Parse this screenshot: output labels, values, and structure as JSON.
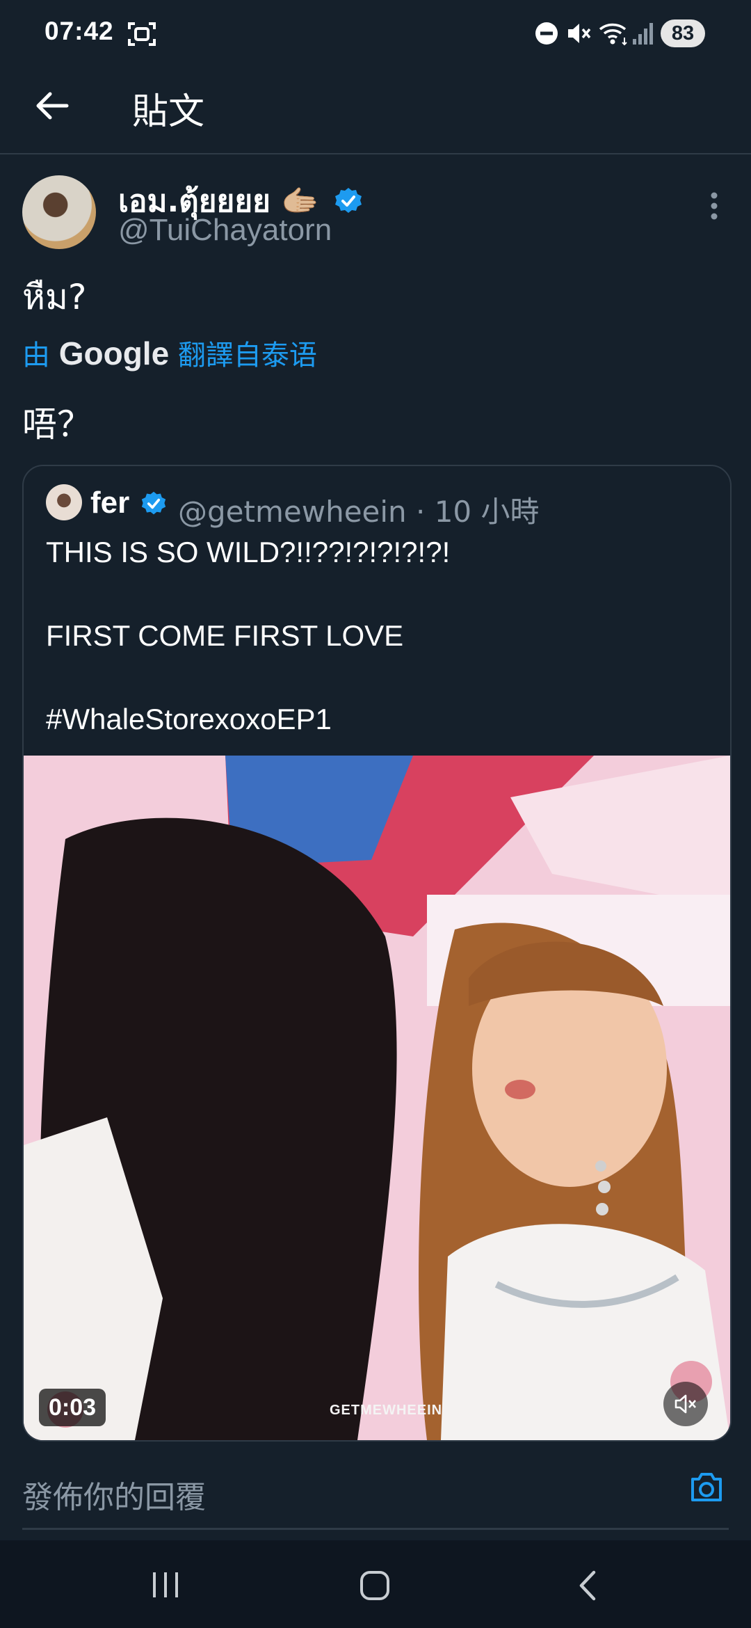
{
  "status_bar": {
    "time": "07:42",
    "battery": "83",
    "icons": [
      "screenshot-icon",
      "dnd-icon",
      "mute-icon",
      "wifi-icon",
      "signal-icon"
    ]
  },
  "header": {
    "back_icon": "back-arrow-icon",
    "title": "貼文"
  },
  "tweet": {
    "author": {
      "name": "เอม.ตุ้ยยยย 🫱🏼",
      "handle": "@TuiChayatorn",
      "verified": true
    },
    "text": "หืม?",
    "translation": {
      "prefix": "由",
      "brand": "Google",
      "suffix": "翻譯自泰语"
    },
    "translated_text": "唔？",
    "quote": {
      "author_name": "fer",
      "verified": true,
      "meta": "@getmewheein · 10 小時",
      "lines": [
        "THIS IS SO WILD?!!??!?!?!?!?!",
        "FIRST COME FIRST LOVE",
        "#WhaleStorexoxoEP1"
      ],
      "media": {
        "duration": "0:03",
        "watermark": "GETMEWHEEIN",
        "muted": true
      }
    }
  },
  "reply": {
    "placeholder": "發佈你的回覆"
  },
  "colors": {
    "background": "#15202b",
    "accent": "#1d9bf0",
    "secondary_text": "#8b98a5",
    "border": "#2f3b47"
  }
}
